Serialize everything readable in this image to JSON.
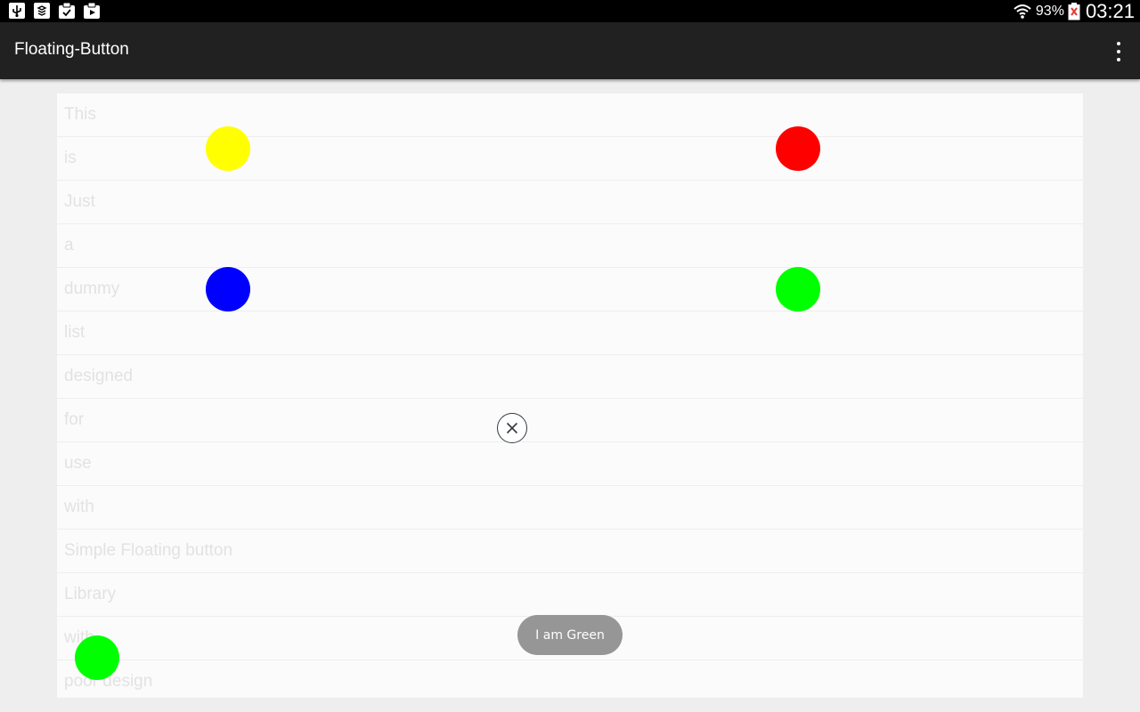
{
  "status_bar": {
    "icons_left": [
      "usb-icon",
      "app-notification-icon",
      "clipboard-check-icon",
      "media-play-icon"
    ],
    "wifi_icon": "wifi-icon",
    "battery_percent": "93%",
    "battery_icon": "battery-alert-icon",
    "time": "03:21"
  },
  "app_bar": {
    "title": "Floating-Button",
    "menu_icon": "more-vert-icon"
  },
  "list": {
    "items": [
      "This",
      "is",
      "Just",
      "a",
      "dummy",
      "list",
      "designed",
      "for",
      "use",
      "with",
      "Simple Floating button",
      "Library",
      "with",
      "poor design"
    ]
  },
  "floating_buttons": {
    "colors": {
      "yellow": "#ffff00",
      "red": "#ff0000",
      "blue": "#0000ff",
      "green": "#00ff00"
    },
    "close_icon": "close-icon"
  },
  "toast": {
    "message": "I am Green"
  }
}
